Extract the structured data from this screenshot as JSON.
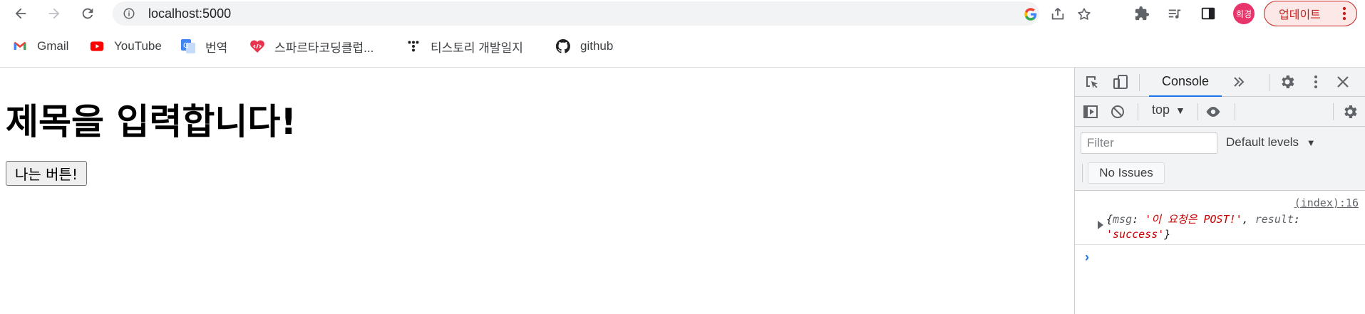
{
  "browser": {
    "url": "localhost:5000",
    "profile_initials": "희경",
    "update_label": "업데이트"
  },
  "bookmarks": [
    {
      "label": "Gmail",
      "icon": "gmail-icon"
    },
    {
      "label": "YouTube",
      "icon": "youtube-icon"
    },
    {
      "label": "번역",
      "icon": "translate-icon"
    },
    {
      "label": "스파르타코딩클럽...",
      "icon": "sparta-icon"
    },
    {
      "label": "티스토리 개발일지",
      "icon": "tistory-icon"
    },
    {
      "label": "github",
      "icon": "github-icon"
    }
  ],
  "page": {
    "heading": "제목을 입력합니다!",
    "button_label": "나는 버튼!"
  },
  "devtools": {
    "tab": "Console",
    "context": "top",
    "filter_placeholder": "Filter",
    "levels": "Default levels",
    "issues": "No Issues",
    "log": {
      "source": "(index):16",
      "open": "{",
      "key1": "msg",
      "val1": "'이 요청은 POST!'",
      "key2": "result",
      "val2": "'success'",
      "close": "}"
    }
  },
  "colors": {
    "accent": "#1a73e8",
    "profile": "#e8336b",
    "update": "#c5221f"
  }
}
